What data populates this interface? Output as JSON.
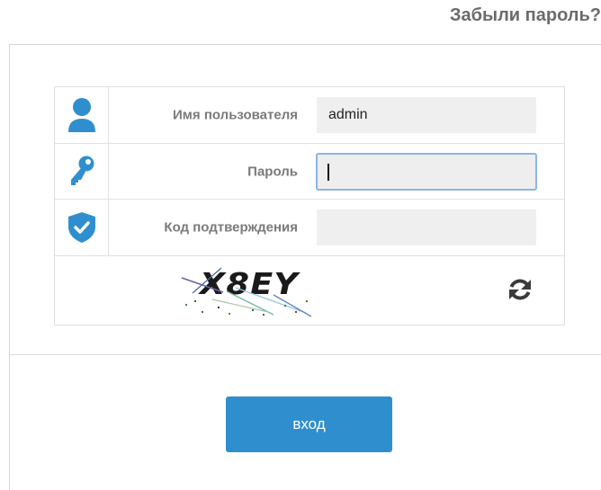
{
  "header": {
    "forgot_password": "Забыли пароль?"
  },
  "form": {
    "username": {
      "label": "Имя пользователя",
      "value": "admin",
      "icon": "user-icon"
    },
    "password": {
      "label": "Пароль",
      "value": "",
      "icon": "key-icon"
    },
    "captcha_code": {
      "label": "Код подтверждения",
      "value": "",
      "icon": "shield-check-icon"
    },
    "captcha": {
      "text": "X8EY",
      "refresh_icon": "refresh-icon"
    }
  },
  "login_button": "вход",
  "colors": {
    "accent": "#2f8fce",
    "field_bg": "#efefef",
    "label": "#7a7a7a",
    "focus_border": "#8fb3e6"
  }
}
